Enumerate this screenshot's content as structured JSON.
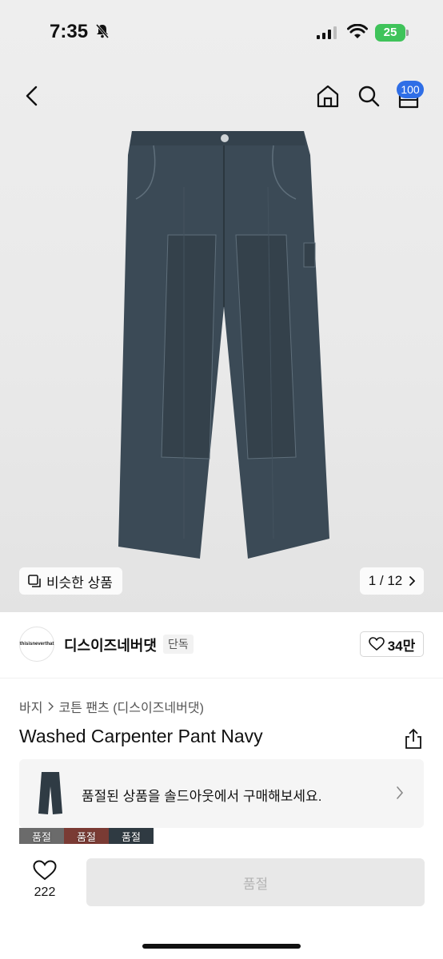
{
  "status_bar": {
    "time": "7:35",
    "battery": "25"
  },
  "header": {
    "cart_count": "100"
  },
  "gallery": {
    "similar_label": "비슷한 상품",
    "page_indicator": "1 / 12"
  },
  "brand": {
    "logo_text": "thisisneverthat",
    "name": "디스이즈네버댓",
    "badge": "단독",
    "likes": "34만"
  },
  "breadcrumb": {
    "category": "바지",
    "sub_category": "코튼 팬츠 (디스이즈네버댓)"
  },
  "product": {
    "title": "Washed Carpenter Pant Navy"
  },
  "soldout_card": {
    "text": "품절된 상품을 솔드아웃에서 구매해보세요."
  },
  "swatches": [
    {
      "label": "품절",
      "color": "#6b6b6b"
    },
    {
      "label": "품절",
      "color": "#7a3b34"
    },
    {
      "label": "품절",
      "color": "#2f3a42"
    }
  ],
  "bottom": {
    "wish_count": "222",
    "buy_label": "품절"
  },
  "colors": {
    "accent": "#2f6ee6",
    "battery": "#3fc35a",
    "pant": "#3b4a56"
  }
}
